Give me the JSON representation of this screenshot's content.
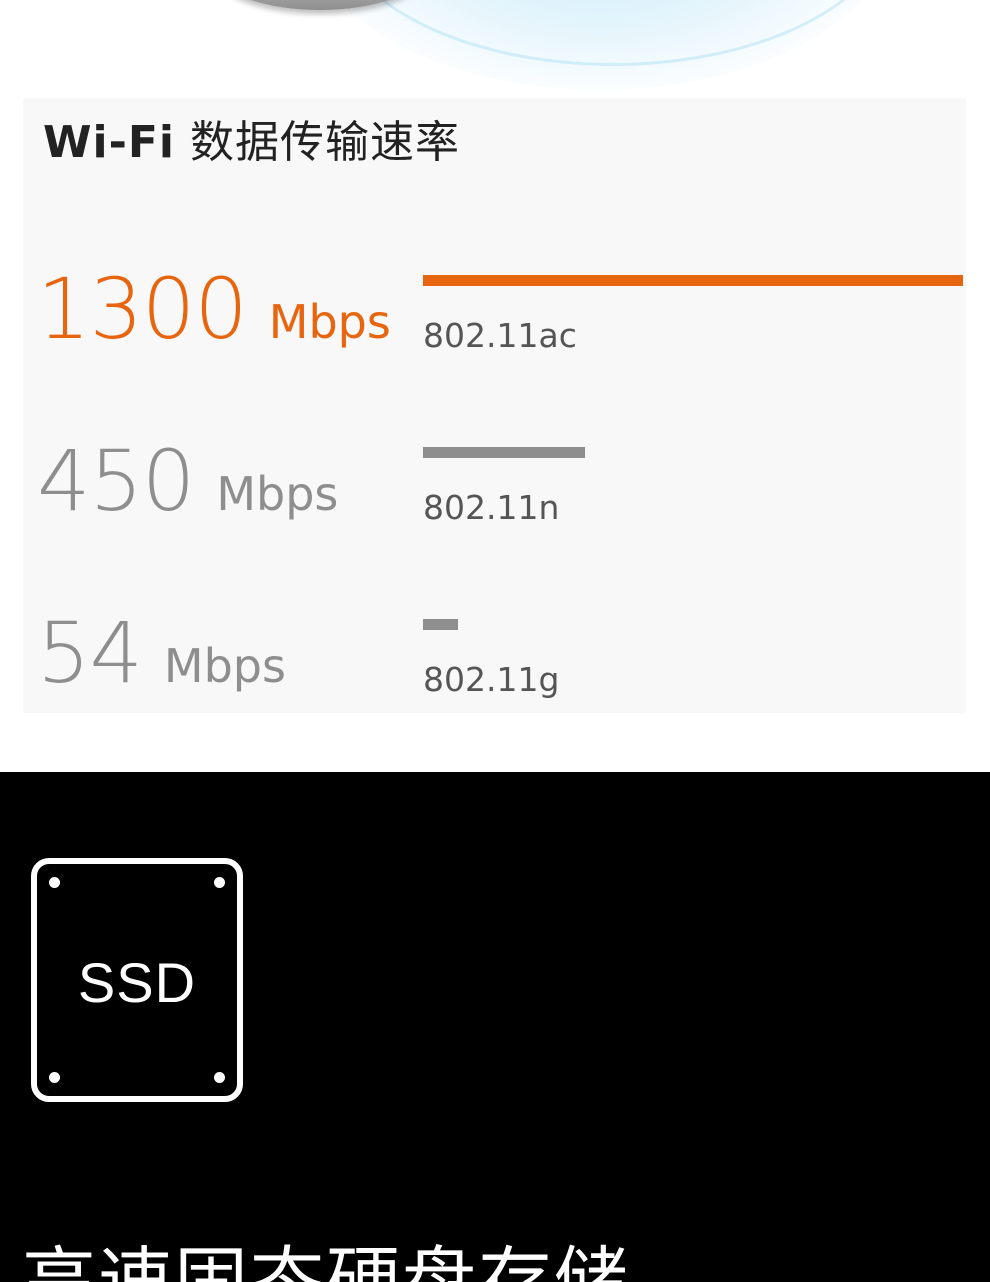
{
  "wifi": {
    "title_latin": "Wi-Fi",
    "title_cn": "数据传输速率",
    "rows": [
      {
        "value": "1300",
        "unit": "Mbps",
        "standard": "802.11ac",
        "relative_speed": 1.0,
        "color": "#e8650f",
        "bar_color": "#e8650f"
      },
      {
        "value": "450",
        "unit": "Mbps",
        "standard": "802.11n",
        "relative_speed": 0.3,
        "color": "#8e8e8e",
        "bar_color": "#8e8e8e"
      },
      {
        "value": "54",
        "unit": "Mbps",
        "standard": "802.11g",
        "relative_speed": 0.065,
        "color": "#8e8e8e",
        "bar_color": "#8e8e8e"
      }
    ]
  },
  "storage": {
    "icon_label": "SSD",
    "headline": "高速固态硬盘存储。"
  },
  "colors": {
    "accent": "#e8650f",
    "muted": "#8e8e8e",
    "dark_bg": "#000000",
    "card_bg": "#f8f8f8"
  },
  "icons": {
    "ssd": "ssd-drive-icon"
  }
}
